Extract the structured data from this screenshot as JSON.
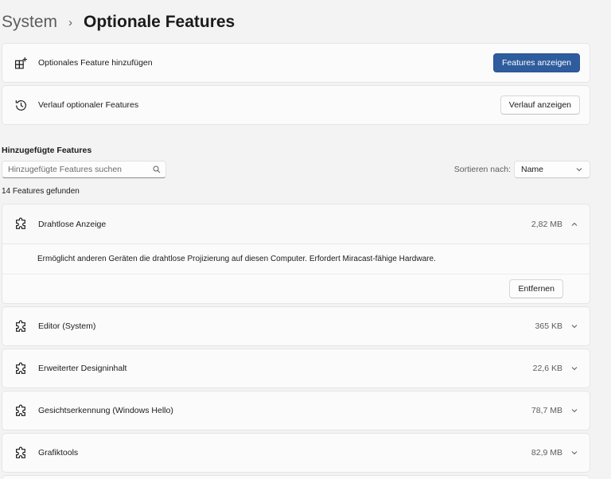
{
  "breadcrumb": {
    "parent": "System",
    "separator": "›",
    "current": "Optionale Features"
  },
  "actions": [
    {
      "icon": "add-feature-icon",
      "label": "Optionales Feature hinzufügen",
      "button": "Features anzeigen",
      "style": "primary"
    },
    {
      "icon": "history-icon",
      "label": "Verlauf optionaler Features",
      "button": "Verlauf anzeigen",
      "style": "secondary"
    }
  ],
  "installed": {
    "title": "Hinzugefügte Features",
    "search_placeholder": "Hinzugefügte Features suchen",
    "sort_label": "Sortieren nach:",
    "sort_value": "Name",
    "count_text": "14 Features gefunden",
    "features": [
      {
        "name": "Drahtlose Anzeige",
        "size": "2,82 MB",
        "expanded": true,
        "description": "Ermöglicht anderen Geräten die drahtlose Projizierung auf diesen Computer. Erfordert Miracast-fähige Hardware.",
        "remove_label": "Entfernen"
      },
      {
        "name": "Editor (System)",
        "size": "365 KB",
        "expanded": false
      },
      {
        "name": "Erweiterter Designinhalt",
        "size": "22,6 KB",
        "expanded": false
      },
      {
        "name": "Gesichtserkennung (Windows Hello)",
        "size": "78,7 MB",
        "expanded": false
      },
      {
        "name": "Grafiktools",
        "size": "82,9 MB",
        "expanded": false
      }
    ]
  },
  "colors": {
    "accent": "#2e5c9d",
    "background": "#f3f3f3",
    "card": "#fbfbfb"
  }
}
